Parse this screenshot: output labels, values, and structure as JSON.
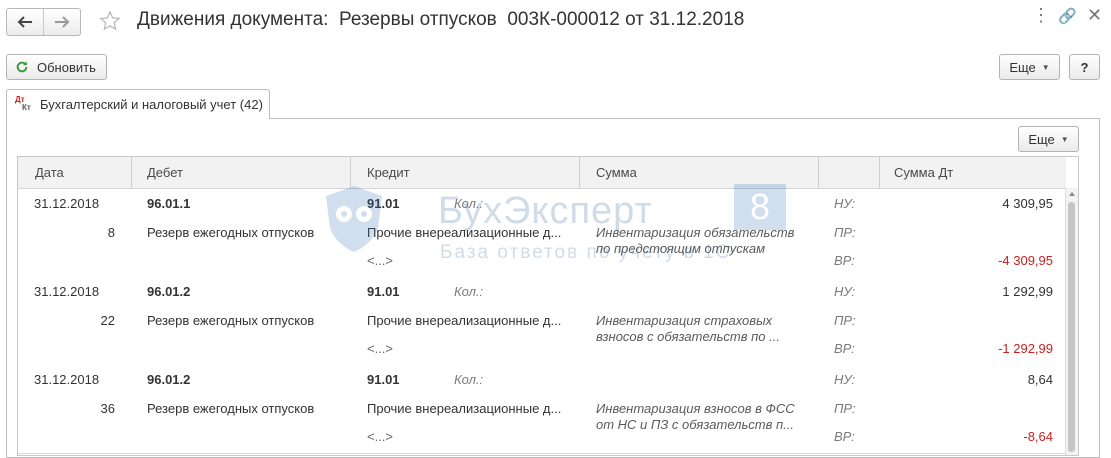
{
  "window": {
    "title": "Движения документа:  Резервы отпусков  003К-000012 от 31.12.2018",
    "controls": [
      "⋮",
      "🔗",
      "✕"
    ]
  },
  "icons": {
    "back": "arrow-left-icon",
    "forward": "arrow-right-icon",
    "favorite": "star-icon",
    "refresh": "refresh-icon",
    "tab": "dt-kt-icon"
  },
  "toolbar": {
    "refresh_label": "Обновить",
    "more_label": "Еще",
    "help_label": "?"
  },
  "tab": {
    "label": "Бухгалтерский и налоговый учет (42)",
    "icon_top": "Дт",
    "icon_bottom": "Кт"
  },
  "panel": {
    "more_label": "Еще"
  },
  "table": {
    "headers": {
      "date": "Дата",
      "debit": "Дебет",
      "credit": "Кредит",
      "sum": "Сумма",
      "sum_dt": "Сумма Дт"
    },
    "rows": [
      {
        "date": "31.12.2018",
        "num": "8",
        "debit_account": "96.01.1",
        "debit_sub": "Резерв ежегодных отпусков",
        "credit_account": "91.01",
        "credit_sub": "Прочие внереализационные д...",
        "credit_sub2": "<...>",
        "qty_label": "Кол.:",
        "content_line1": "Инвентаризация обязательств",
        "content_line2": "по предстоящим отпускам",
        "nu_label": "НУ:",
        "pr_label": "ПР:",
        "vr_label": "ВР:",
        "nu_value": "4 309,95",
        "vr_value": "-4 309,95"
      },
      {
        "date": "31.12.2018",
        "num": "22",
        "debit_account": "96.01.2",
        "debit_sub": "Резерв ежегодных отпусков",
        "credit_account": "91.01",
        "credit_sub": "Прочие внереализационные д...",
        "credit_sub2": "<...>",
        "qty_label": "Кол.:",
        "content_line1": "Инвентаризация страховых",
        "content_line2": "взносов с обязательств по ...",
        "nu_label": "НУ:",
        "pr_label": "ПР:",
        "vr_label": "ВР:",
        "nu_value": "1 292,99",
        "vr_value": "-1 292,99"
      },
      {
        "date": "31.12.2018",
        "num": "36",
        "debit_account": "96.01.2",
        "debit_sub": "Резерв ежегодных отпусков",
        "credit_account": "91.01",
        "credit_sub": "Прочие внереализационные д...",
        "credit_sub2": "<...>",
        "qty_label": "Кол.:",
        "content_line1": "Инвентаризация взносов в ФСС",
        "content_line2": "от НС и ПЗ с обязательств п...",
        "nu_label": "НУ:",
        "pr_label": "ПР:",
        "vr_label": "ВР:",
        "nu_value": "8,64",
        "vr_value": "-8,64"
      }
    ]
  },
  "watermark": {
    "brand": "БухЭксперт",
    "badge": "8",
    "subtitle": "База ответов по учету в 1С"
  },
  "colors": {
    "negative": "#cc1e1e",
    "header_bg": "#f2f2f2",
    "accent_green": "#3a9a3a"
  }
}
